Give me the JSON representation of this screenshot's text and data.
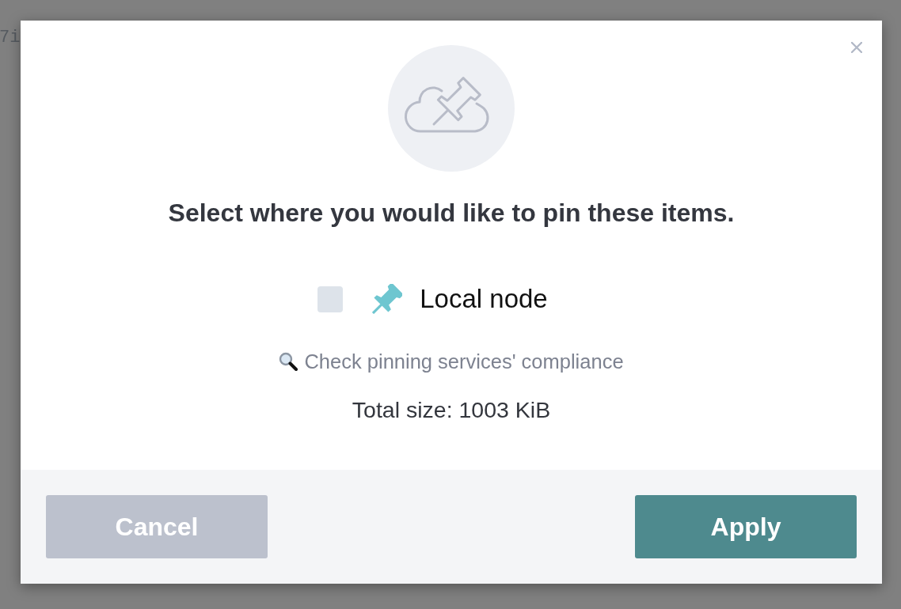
{
  "background": {
    "text": "7i"
  },
  "dialog": {
    "title": "Select where you would like to pin these items.",
    "options": [
      {
        "label": "Local node",
        "checked": false
      }
    ],
    "compliance_link": "Check pinning services' compliance",
    "total_size": "Total size: 1003 KiB",
    "buttons": [
      {
        "label": "Cancel",
        "kind": "secondary"
      },
      {
        "label": "Apply",
        "kind": "primary"
      }
    ]
  }
}
